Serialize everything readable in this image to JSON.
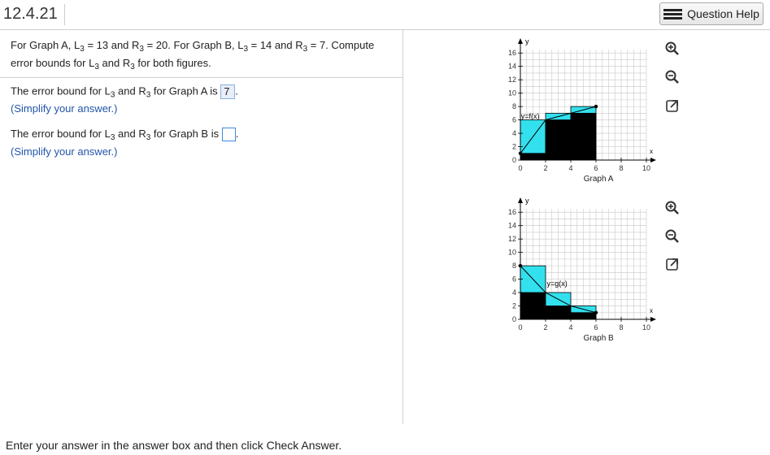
{
  "header": {
    "question_number": "12.4.21",
    "help_label": "Question Help"
  },
  "prompt": {
    "p1": "For Graph A, L",
    "p1_sub": "3",
    "p2": " = 13 and R",
    "p2_sub": "3",
    "p3": " = 20. For Graph B, L",
    "p3_sub": "3",
    "p4": " = 14 and R",
    "p4_sub": "3",
    "p5": " = 7. Compute",
    "p6": "error bounds for L",
    "p6_sub": "3",
    "p7": " and R",
    "p7_sub": "3",
    "p8": " for both figures."
  },
  "answer_a": {
    "t1": "The error bound for L",
    "t1_sub": "3",
    "t2": " and R",
    "t2_sub": "3",
    "t3": " for Graph A is ",
    "value": "7",
    "t4": ".",
    "hint": "(Simplify your answer.)"
  },
  "answer_b": {
    "t1": "The error bound for L",
    "t1_sub": "3",
    "t2": " and R",
    "t2_sub": "3",
    "t3": " for Graph B is ",
    "value": "",
    "t4": ".",
    "hint": "(Simplify your answer.)"
  },
  "graph_a": {
    "caption": "Graph A",
    "function_label": "y=f(x)",
    "y_axis_label": "y",
    "x_axis_label": "x",
    "y_ticks": [
      "16",
      "14",
      "12",
      "10",
      "8",
      "6",
      "4",
      "2",
      "0"
    ],
    "x_ticks": [
      "0",
      "2",
      "4",
      "6",
      "8",
      "10"
    ],
    "x_values": [
      0,
      2,
      4,
      6
    ],
    "left_heights": [
      1,
      6,
      7
    ],
    "right_heights": [
      6,
      7,
      8
    ],
    "curve_points": [
      [
        0,
        1
      ],
      [
        2,
        6
      ],
      [
        4,
        7
      ],
      [
        6,
        8
      ]
    ]
  },
  "graph_b": {
    "caption": "Graph B",
    "function_label": "y=g(x)",
    "y_axis_label": "y",
    "x_axis_label": "x",
    "y_ticks": [
      "16",
      "14",
      "12",
      "10",
      "8",
      "6",
      "4",
      "2",
      "0"
    ],
    "x_ticks": [
      "0",
      "2",
      "4",
      "6",
      "8",
      "10"
    ],
    "x_values": [
      0,
      2,
      4,
      6
    ],
    "left_heights": [
      8,
      4,
      2
    ],
    "right_heights": [
      4,
      2,
      1
    ],
    "curve_points": [
      [
        0,
        8
      ],
      [
        2,
        4
      ],
      [
        4,
        2
      ],
      [
        6,
        1
      ]
    ]
  },
  "footer": {
    "text": "Enter your answer in the answer box and then click Check Answer."
  },
  "colors": {
    "accent": "#3f8ae0",
    "hint": "#2255aa",
    "cyan_fill": "#33e0ee",
    "bar_fill": "#000000"
  },
  "icons": [
    "zoom-in-icon",
    "zoom-out-icon",
    "popout-icon"
  ]
}
